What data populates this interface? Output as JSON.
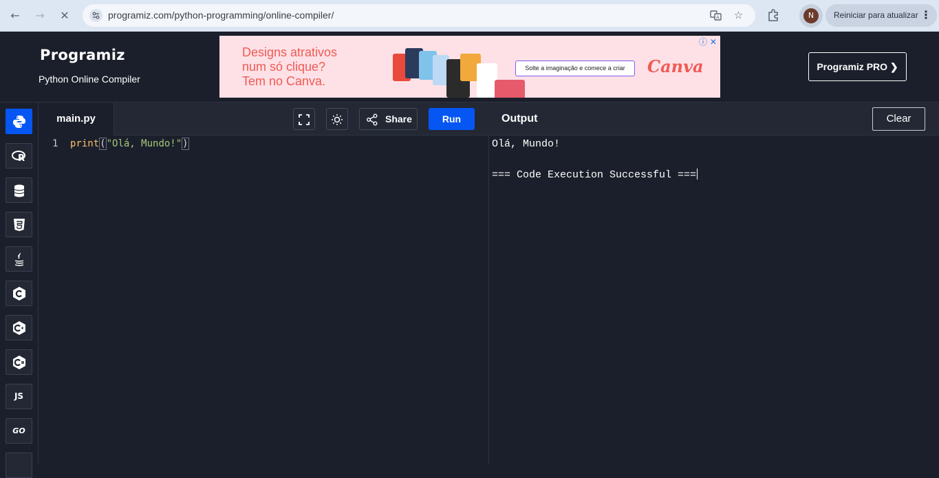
{
  "browser": {
    "url": "programiz.com/python-programming/online-compiler/",
    "avatar_initial": "N",
    "update_label": "Reiniciar para atualizar"
  },
  "header": {
    "logo": "Programiz",
    "subtitle": "Python Online Compiler",
    "pro_button": "Programiz PRO ❯"
  },
  "ad": {
    "line1": "Designs atrativos",
    "line2": "num só clique?",
    "line3": "Tem no Canva.",
    "cta": "Solte a imaginação e comece a criar",
    "brand": "Canva"
  },
  "sidebar": {
    "items": [
      {
        "name": "python",
        "active": true
      },
      {
        "name": "r"
      },
      {
        "name": "sql"
      },
      {
        "name": "html"
      },
      {
        "name": "java"
      },
      {
        "name": "c"
      },
      {
        "name": "cpp"
      },
      {
        "name": "csharp"
      },
      {
        "name": "js",
        "label": "JS"
      },
      {
        "name": "go",
        "label": "GO"
      }
    ]
  },
  "editor": {
    "file_tab": "main.py",
    "share_label": "Share",
    "run_label": "Run",
    "line_number": "1",
    "code": {
      "fn": "print",
      "open": "(",
      "str": "\"Olá, Mundo!\"",
      "close": ")"
    }
  },
  "output": {
    "title": "Output",
    "clear_label": "Clear",
    "lines": [
      "Olá, Mundo!",
      "",
      "=== Code Execution Successful ==="
    ]
  },
  "colors": {
    "accent": "#0556f3",
    "background": "#1b1f2b",
    "toolbar": "#232834",
    "ad_text": "#f05a55"
  }
}
